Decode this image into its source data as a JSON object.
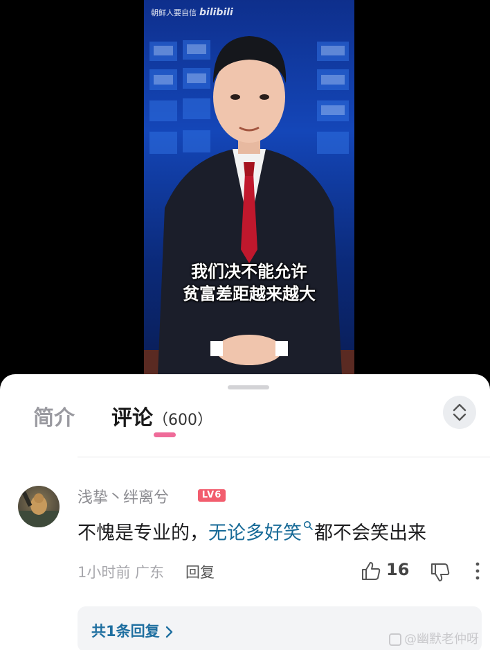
{
  "video": {
    "watermark_text": "朝鲜人要自信",
    "watermark_brand": "bilibili",
    "subtitle_line1": "我们决不能允许",
    "subtitle_line2": "贫富差距越来越大"
  },
  "tabs": {
    "intro_label": "简介",
    "comments_label": "评论",
    "comments_count": "（600）"
  },
  "comment": {
    "username": "浅挚丶绊离兮",
    "level": "LV6",
    "text_before": "不愧是专业的，",
    "keyword": "无论多好笑",
    "text_after": "都不会笑出来",
    "time": "1小时前 广东",
    "reply_label": "回复",
    "like_count": "16",
    "replies_link": "共1条回复"
  },
  "source_watermark": "@幽默老仲呀",
  "icons": {
    "expand": "chevron-updown-icon",
    "like": "thumbs-up-icon",
    "dislike": "thumbs-down-icon",
    "more": "more-vertical-icon",
    "search": "search-icon",
    "arrow": "chevron-right-icon"
  },
  "colors": {
    "accent_pink": "#ef6b99",
    "keyword_blue": "#176a97",
    "level_badge": "#f25d6e"
  }
}
